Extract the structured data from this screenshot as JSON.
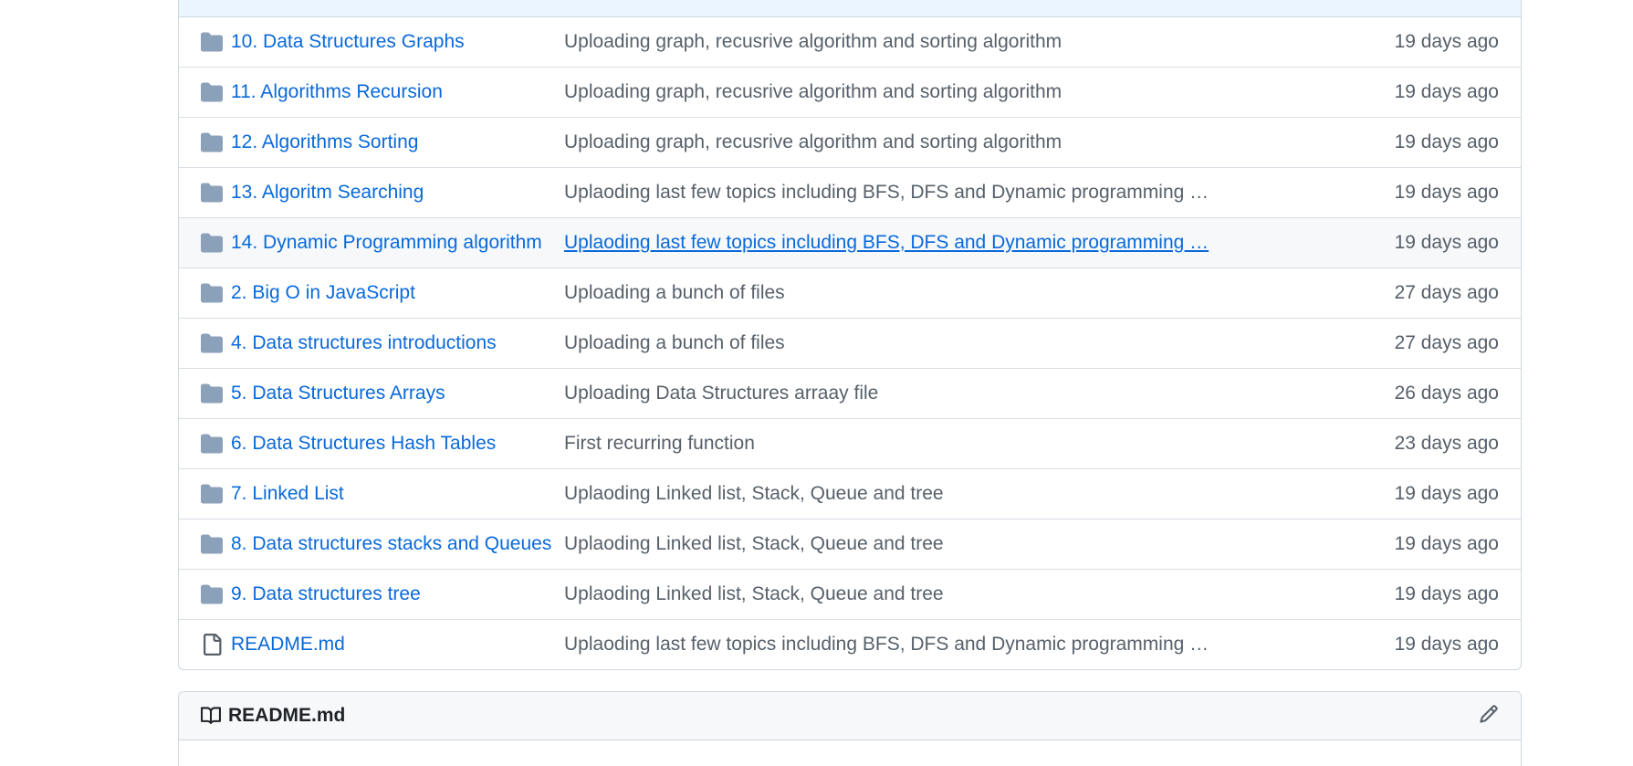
{
  "files": [
    {
      "type": "folder",
      "name": "10. Data Structures Graphs",
      "message": "Uploading graph, recusrive algorithm and sorting algorithm",
      "age": "19 days ago"
    },
    {
      "type": "folder",
      "name": "11. Algorithms Recursion",
      "message": "Uploading graph, recusrive algorithm and sorting algorithm",
      "age": "19 days ago"
    },
    {
      "type": "folder",
      "name": "12. Algorithms Sorting",
      "message": "Uploading graph, recusrive algorithm and sorting algorithm",
      "age": "19 days ago"
    },
    {
      "type": "folder",
      "name": "13. Algoritm Searching",
      "message": "Uplaoding last few topics including BFS, DFS and Dynamic programming …",
      "age": "19 days ago"
    },
    {
      "type": "folder",
      "name": "14. Dynamic Programming algorithm",
      "message": "Uplaoding last few topics including BFS, DFS and Dynamic programming …",
      "age": "19 days ago",
      "hovered": true
    },
    {
      "type": "folder",
      "name": "2. Big O in JavaScript",
      "message": "Uploading a bunch of files",
      "age": "27 days ago"
    },
    {
      "type": "folder",
      "name": "4. Data structures introductions",
      "message": "Uploading a bunch of files",
      "age": "27 days ago"
    },
    {
      "type": "folder",
      "name": "5. Data Structures Arrays",
      "message": "Uploading Data Structures arraay file",
      "age": "26 days ago"
    },
    {
      "type": "folder",
      "name": "6. Data Structures Hash Tables",
      "message": "First recurring function",
      "age": "23 days ago"
    },
    {
      "type": "folder",
      "name": "7. Linked List",
      "message": "Uplaoding Linked list, Stack, Queue and tree",
      "age": "19 days ago"
    },
    {
      "type": "folder",
      "name": "8. Data structures stacks and Queues",
      "message": "Uplaoding Linked list, Stack, Queue and tree",
      "age": "19 days ago"
    },
    {
      "type": "folder",
      "name": "9. Data structures tree",
      "message": "Uplaoding Linked list, Stack, Queue and tree",
      "age": "19 days ago"
    },
    {
      "type": "file",
      "name": "README.md",
      "message": "Uplaoding last few topics including BFS, DFS and Dynamic programming …",
      "age": "19 days ago"
    }
  ],
  "readme": {
    "title": "README.md",
    "icon": "book-icon",
    "edit_icon": "pencil-icon"
  },
  "colors": {
    "link": "#0969da",
    "folder_icon": "#8ba0b9",
    "muted": "#57606a",
    "border": "#d0d7de",
    "header_bg": "#f6f8fa",
    "commit_header_bg": "#eaf5ff"
  }
}
